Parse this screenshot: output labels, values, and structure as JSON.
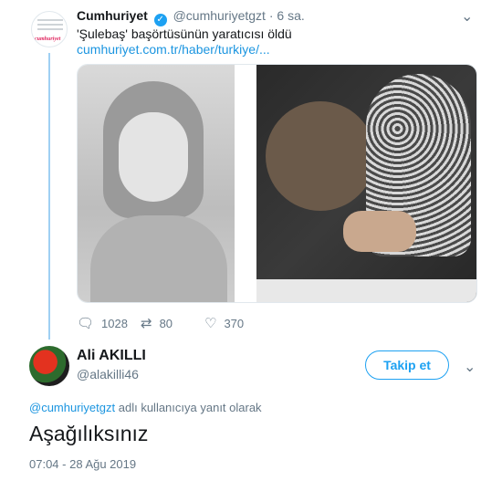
{
  "quoted_tweet": {
    "name": "Cumhuriyet",
    "verified": true,
    "handle": "@cumhuriyetgzt",
    "separator": "·",
    "time": "6 sa.",
    "avatar_logo_text": "cumhuriyet",
    "text": "'Şulebaş' başörtüsünün yaratıcısı öldü",
    "link": "cumhuriyet.com.tr/haber/turkiye/...",
    "actions": {
      "reply_count": "1028",
      "retweet_count": "80",
      "like_count": "370"
    }
  },
  "reply_tweet": {
    "name": "Ali AKILLI",
    "handle": "@alakilli46",
    "follow_label": "Takip et",
    "replying_mention": "@cumhuriyetgzt",
    "replying_suffix": "adlı kullanıcıya yanıt olarak",
    "text": "Aşağılıksınız",
    "timestamp": "07:04 - 28 Ağu 2019"
  },
  "icons": {
    "caret": "chevron-down-icon",
    "reply": "reply-icon",
    "retweet": "retweet-icon",
    "like": "heart-icon",
    "verified": "verified-badge-icon"
  },
  "colors": {
    "accent": "#1da1f2",
    "link": "#1b95e0",
    "secondary_text": "#657786",
    "thread_line": "#9fd0f3"
  }
}
